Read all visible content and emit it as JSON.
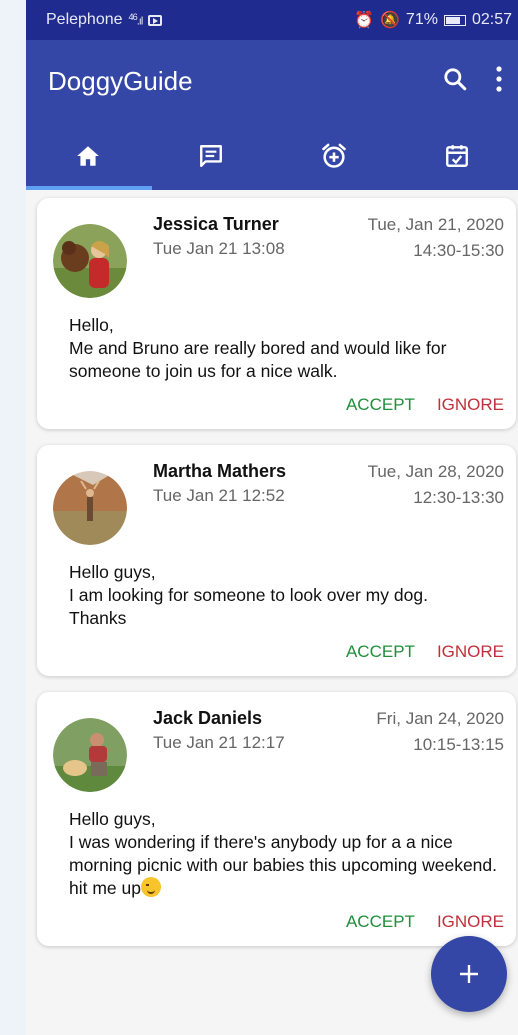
{
  "status_bar": {
    "carrier": "Pelephone",
    "signal": "46",
    "battery": "71%",
    "time": "02:57"
  },
  "app_bar": {
    "title": "DoggyGuide",
    "icons": [
      "search-icon",
      "more-vert-icon"
    ]
  },
  "tabs": [
    {
      "icon": "home-icon",
      "selected": true
    },
    {
      "icon": "message-icon",
      "selected": false
    },
    {
      "icon": "alarm-add-icon",
      "selected": false
    },
    {
      "icon": "event-available-icon",
      "selected": false
    }
  ],
  "requests": [
    {
      "name": "Jessica Turner",
      "posted": "Tue Jan 21 13:08",
      "date": "Tue, Jan 21, 2020",
      "time_range": "14:30-15:30",
      "message_lines": [
        "Hello,",
        "Me and Bruno are really bored and would like for someone to join us for a nice walk."
      ],
      "accept_label": "ACCEPT",
      "ignore_label": "IGNORE"
    },
    {
      "name": "Martha Mathers",
      "posted": "Tue Jan 21 12:52",
      "date": "Tue, Jan 28, 2020",
      "time_range": "12:30-13:30",
      "message_lines": [
        "Hello guys,",
        "I am looking for someone to look over my dog.",
        "Thanks"
      ],
      "accept_label": "ACCEPT",
      "ignore_label": "IGNORE"
    },
    {
      "name": "Jack Daniels",
      "posted": "Tue Jan 21 12:17",
      "date": "Fri, Jan 24, 2020",
      "time_range": "10:15-13:15",
      "message_lines": [
        "Hello guys,",
        "I was wondering if there's anybody up for a a nice morning picnic with our babies this upcoming weekend.",
        "hit me up"
      ],
      "accept_label": "ACCEPT",
      "ignore_label": "IGNORE"
    }
  ],
  "fab": {
    "icon": "add-icon"
  },
  "colors": {
    "primary": "#3446a6",
    "status_bar": "#1f2b8e",
    "tab_indicator": "#5ea0f2",
    "accept": "#1f8f3a",
    "ignore": "#c0303a"
  }
}
